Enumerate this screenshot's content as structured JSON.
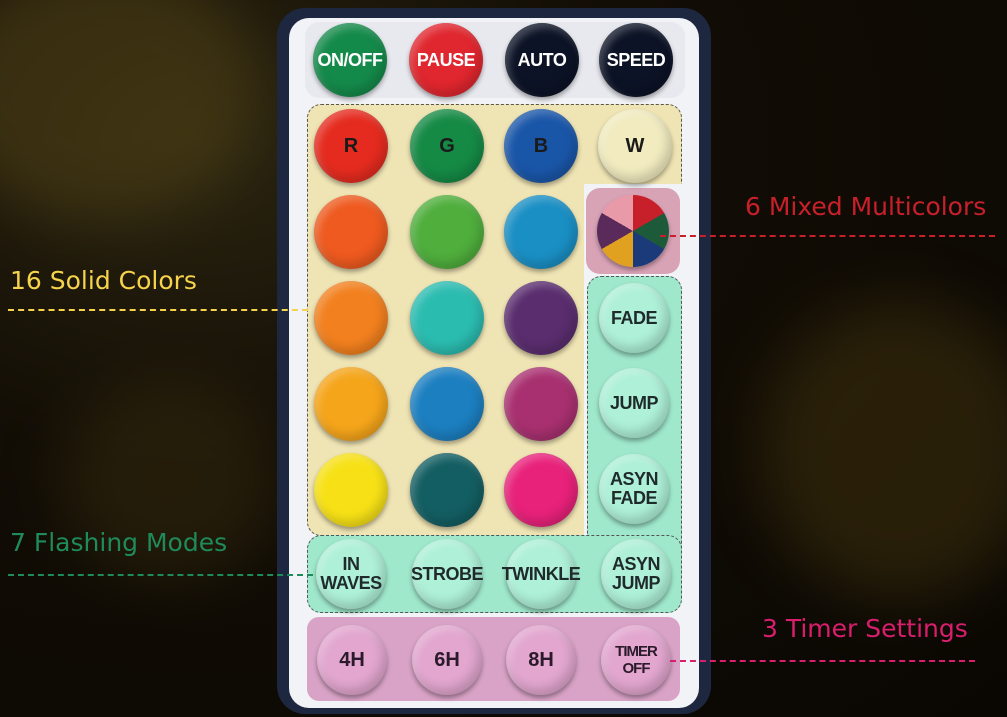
{
  "top_buttons": [
    {
      "label": "ON/OFF",
      "color": "#148a4a"
    },
    {
      "label": "PAUSE",
      "color": "#e0262e"
    },
    {
      "label": "AUTO",
      "color": "#0c1326"
    },
    {
      "label": "SPEED",
      "color": "#0c1326"
    }
  ],
  "rgbw": [
    {
      "label": "R",
      "color": "#e52b1f"
    },
    {
      "label": "G",
      "color": "#158a45"
    },
    {
      "label": "B",
      "color": "#1a56a8"
    },
    {
      "label": "W",
      "color": "#f1ebbf"
    }
  ],
  "solid_colors": [
    "#ee5a1f",
    "#4fae3c",
    "#1a8fc4",
    "#f2801e",
    "#2bbcb0",
    "#5a2d6e",
    "#f5a51a",
    "#1c7fc0",
    "#a83070",
    "#f7e116",
    "#135e62",
    "#e8217a"
  ],
  "multicolor_icon": "color-wheel-icon",
  "modes_side": [
    "FADE",
    "JUMP",
    "ASYN\nFADE"
  ],
  "modes_bottom": [
    "IN\nWAVES",
    "STROBE",
    "TWINKLE",
    "ASYN\nJUMP"
  ],
  "timers": [
    "4H",
    "6H",
    "8H",
    "TIMER OFF"
  ],
  "callouts": {
    "solid": {
      "text": "16 Solid Colors",
      "color": "#f6d34a"
    },
    "multi": {
      "text": "6 Mixed Multicolors",
      "color": "#c8202a"
    },
    "flash": {
      "text": "7 Flashing Modes",
      "color": "#1f8a5a"
    },
    "timer": {
      "text": "3 Timer Settings",
      "color": "#d81e6c"
    }
  }
}
